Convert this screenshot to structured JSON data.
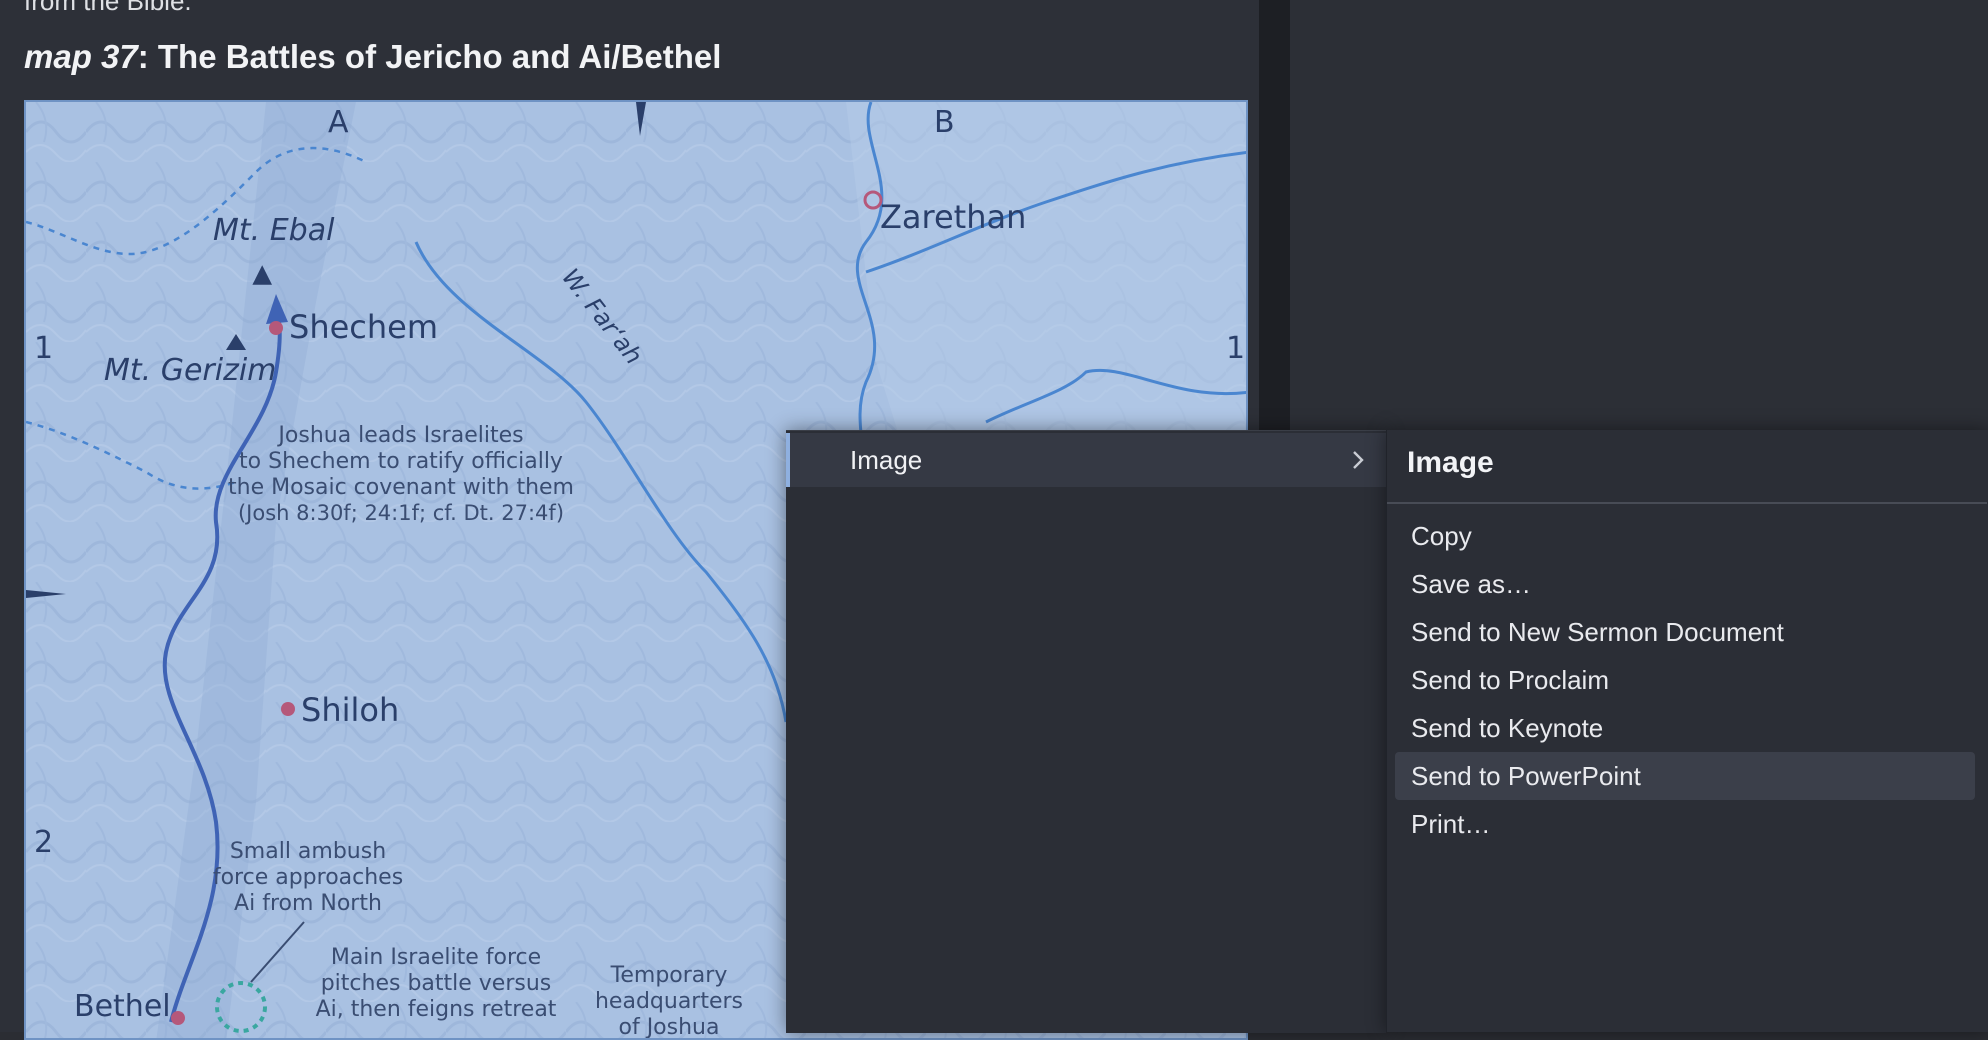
{
  "document": {
    "intro_text": "from the Bible.",
    "map_heading_number": "map 37",
    "map_heading_title": ": The Battles of Jericho and Ai/Bethel"
  },
  "map": {
    "grid_labels": {
      "col_a": "A",
      "col_b": "B",
      "row_1_left": "1",
      "row_1_right": "1",
      "row_2_left": "2"
    },
    "places": {
      "mt_ebal": "Mt. Ebal",
      "mt_gerizim": "Mt. Gerizim",
      "shechem": "Shechem",
      "zarethan": "Zarethan",
      "shiloh": "Shiloh",
      "bethel": "Bethel",
      "wadi_farah": "W. Far‘ah"
    },
    "notes": {
      "joshua_1": "Joshua leads Israelites",
      "joshua_2": "to Shechem to ratify officially",
      "joshua_3": "the Mosaic covenant with them",
      "joshua_4": "(Josh 8:30f; 24:1f; cf. Dt. 27:4f)",
      "ambush_1": "Small ambush",
      "ambush_2": "force approaches",
      "ambush_3": "Ai from North",
      "main_1": "Main Israelite force",
      "main_2": "pitches battle versus",
      "main_3": "Ai, then feigns retreat",
      "temp_1": "Temporary",
      "temp_2": "headquarters",
      "temp_3": "of Joshua"
    },
    "colors": {
      "water": "#4a86d0",
      "route": "#3f63b5",
      "city": "#b5587a",
      "ambush": "#3aa7a0"
    }
  },
  "context_menu": {
    "main_item": "Image",
    "submenu": {
      "title": "Image",
      "items": [
        "Copy",
        "Save as…",
        "Send to New Sermon Document",
        "Send to Proclaim",
        "Send to Keynote",
        "Send to PowerPoint",
        "Print…"
      ],
      "active_index": 5
    }
  }
}
